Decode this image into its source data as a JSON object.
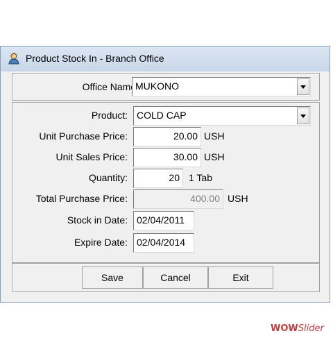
{
  "window": {
    "title": "Product Stock In -  Branch Office"
  },
  "office": {
    "label": "Office Name:",
    "value": "MUKONO"
  },
  "product": {
    "label": "Product:",
    "value": "COLD CAP"
  },
  "unit_purchase_price": {
    "label": "Unit Purchase Price:",
    "value": "20.00",
    "unit": "USH"
  },
  "unit_sales_price": {
    "label": "Unit Sales Price:",
    "value": "30.00",
    "unit": "USH"
  },
  "quantity": {
    "label": "Quantity:",
    "value": "20",
    "unit": "1 Tab"
  },
  "total_purchase_price": {
    "label": "Total Purchase Price:",
    "value": "400.00",
    "unit": "USH"
  },
  "stock_in_date": {
    "label": "Stock in Date:",
    "value": "02/04/2011"
  },
  "expire_date": {
    "label": "Expire Date:",
    "value": "02/04/2014"
  },
  "buttons": {
    "save": "Save",
    "cancel": "Cancel",
    "exit": "Exit"
  },
  "watermark": {
    "brand": "WOW",
    "suffix": "Slider"
  },
  "colors": {
    "titlebar": "#c7d6e8",
    "window_bg": "#f0f0f0",
    "disabled_text": "#808080"
  },
  "icons": {
    "title": "user-icon",
    "dropdown": "chevron-down-icon"
  }
}
